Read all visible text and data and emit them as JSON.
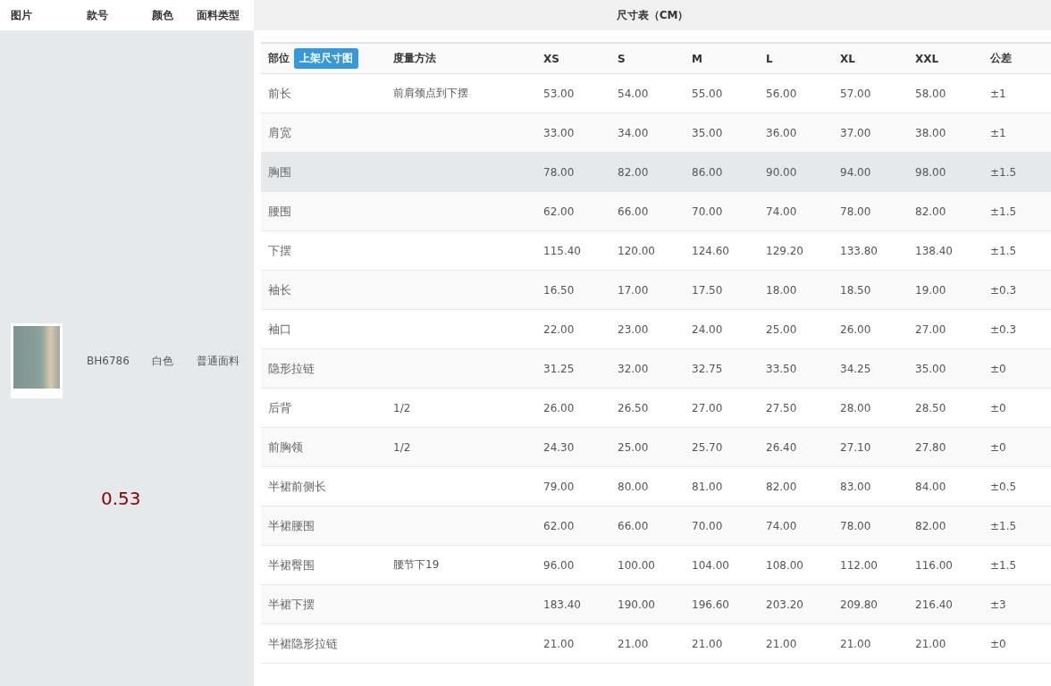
{
  "left_header": [
    "图片",
    "款号",
    "颜色",
    "面料类型"
  ],
  "product": {
    "style_no": "BH6786",
    "color_label": "白色",
    "fabric": "普通面料"
  },
  "overlay_value": "0.53",
  "size_table": {
    "title": "尺寸表（CM）",
    "upload_button": "上架尺寸图",
    "columns": [
      "部位",
      "度量方法",
      "XS",
      "S",
      "M",
      "L",
      "XL",
      "XXL",
      "公差"
    ],
    "rows": [
      {
        "cells": [
          "前长",
          "前肩颈点到下摆",
          "53.00",
          "54.00",
          "55.00",
          "56.00",
          "57.00",
          "58.00",
          "±1"
        ],
        "selected": false
      },
      {
        "cells": [
          "肩宽",
          "",
          "33.00",
          "34.00",
          "35.00",
          "36.00",
          "37.00",
          "38.00",
          "±1"
        ],
        "selected": false
      },
      {
        "cells": [
          "胸围",
          "",
          "78.00",
          "82.00",
          "86.00",
          "90.00",
          "94.00",
          "98.00",
          "±1.5"
        ],
        "selected": true
      },
      {
        "cells": [
          "腰围",
          "",
          "62.00",
          "66.00",
          "70.00",
          "74.00",
          "78.00",
          "82.00",
          "±1.5"
        ],
        "selected": false
      },
      {
        "cells": [
          "下摆",
          "",
          "115.40",
          "120.00",
          "124.60",
          "129.20",
          "133.80",
          "138.40",
          "±1.5"
        ],
        "selected": false
      },
      {
        "cells": [
          "袖长",
          "",
          "16.50",
          "17.00",
          "17.50",
          "18.00",
          "18.50",
          "19.00",
          "±0.3"
        ],
        "selected": false
      },
      {
        "cells": [
          "袖口",
          "",
          "22.00",
          "23.00",
          "24.00",
          "25.00",
          "26.00",
          "27.00",
          "±0.3"
        ],
        "selected": false
      },
      {
        "cells": [
          "隐形拉链",
          "",
          "31.25",
          "32.00",
          "32.75",
          "33.50",
          "34.25",
          "35.00",
          "±0"
        ],
        "selected": false
      },
      {
        "cells": [
          "后背",
          "1/2",
          "26.00",
          "26.50",
          "27.00",
          "27.50",
          "28.00",
          "28.50",
          "±0"
        ],
        "selected": false
      },
      {
        "cells": [
          "前胸领",
          "1/2",
          "24.30",
          "25.00",
          "25.70",
          "26.40",
          "27.10",
          "27.80",
          "±0"
        ],
        "selected": false
      },
      {
        "cells": [
          "半裙前侧长",
          "",
          "79.00",
          "80.00",
          "81.00",
          "82.00",
          "83.00",
          "84.00",
          "±0.5"
        ],
        "selected": false
      },
      {
        "cells": [
          "半裙腰围",
          "",
          "62.00",
          "66.00",
          "70.00",
          "74.00",
          "78.00",
          "82.00",
          "±1.5"
        ],
        "selected": false
      },
      {
        "cells": [
          "半裙臀围",
          "腰节下19",
          "96.00",
          "100.00",
          "104.00",
          "108.00",
          "112.00",
          "116.00",
          "±1.5"
        ],
        "selected": false
      },
      {
        "cells": [
          "半裙下摆",
          "",
          "183.40",
          "190.00",
          "196.60",
          "203.20",
          "209.80",
          "216.40",
          "±3"
        ],
        "selected": false
      },
      {
        "cells": [
          "半裙隐形拉链",
          "",
          "21.00",
          "21.00",
          "21.00",
          "21.00",
          "21.00",
          "21.00",
          "±0"
        ],
        "selected": false
      }
    ]
  }
}
